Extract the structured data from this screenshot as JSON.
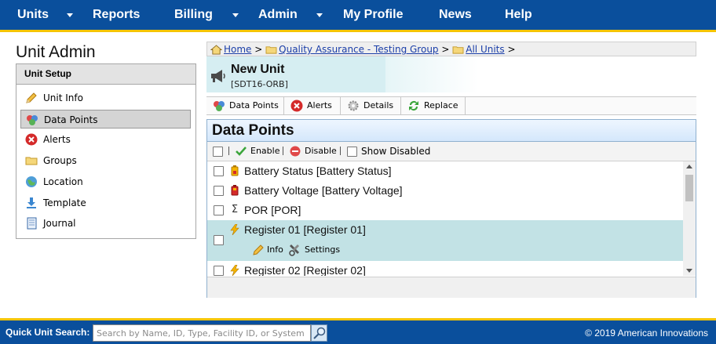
{
  "nav": {
    "units": "Units",
    "reports": "Reports",
    "billing": "Billing",
    "admin": "Admin",
    "my_profile": "My Profile",
    "news": "News",
    "help": "Help"
  },
  "page_title": "Unit Admin",
  "unit_setup": {
    "header": "Unit Setup",
    "items": [
      {
        "label": "Unit Info",
        "icon": "pencil-icon"
      },
      {
        "label": "Data Points",
        "icon": "data-points-icon"
      },
      {
        "label": "Alerts",
        "icon": "alert-icon"
      },
      {
        "label": "Groups",
        "icon": "folder-icon"
      },
      {
        "label": "Location",
        "icon": "globe-icon"
      },
      {
        "label": "Template",
        "icon": "download-icon"
      },
      {
        "label": "Journal",
        "icon": "journal-icon"
      }
    ]
  },
  "breadcrumb": {
    "home": "Home",
    "group": "Quality Assurance - Testing Group",
    "all_units": "All Units",
    "separator": ">"
  },
  "unit": {
    "name": "New Unit",
    "id": "[SDT16-ORB]"
  },
  "tabs": {
    "data_points": "Data Points",
    "alerts": "Alerts",
    "details": "Details",
    "replace": "Replace"
  },
  "data_points": {
    "title": "Data Points",
    "enable": "Enable",
    "disable": "Disable",
    "show_disabled": "Show Disabled",
    "separator": "|",
    "rows": [
      {
        "label": "Battery Status [Battery Status]",
        "icon": "battery-status-icon"
      },
      {
        "label": "Battery Voltage [Battery Voltage]",
        "icon": "battery-voltage-icon"
      },
      {
        "label": "POR [POR]",
        "icon": "sigma-icon",
        "glyph": "Σ"
      },
      {
        "label": "Register 01 [Register 01]",
        "icon": "lightning-icon",
        "selected": true
      },
      {
        "label": "Register 02 [Register 02]",
        "icon": "lightning-icon"
      }
    ],
    "row_actions": {
      "info": "Info",
      "settings": "Settings"
    }
  },
  "quick_search": {
    "label": "Quick Unit Search:",
    "placeholder": "Search by Name, ID, Type, Facility ID, or System Serial"
  },
  "copyright": "© 2019 American Innovations",
  "colors": {
    "nav_bg": "#0a4f9c",
    "accent": "#f5c400",
    "selected_row": "#c2e2e5"
  }
}
